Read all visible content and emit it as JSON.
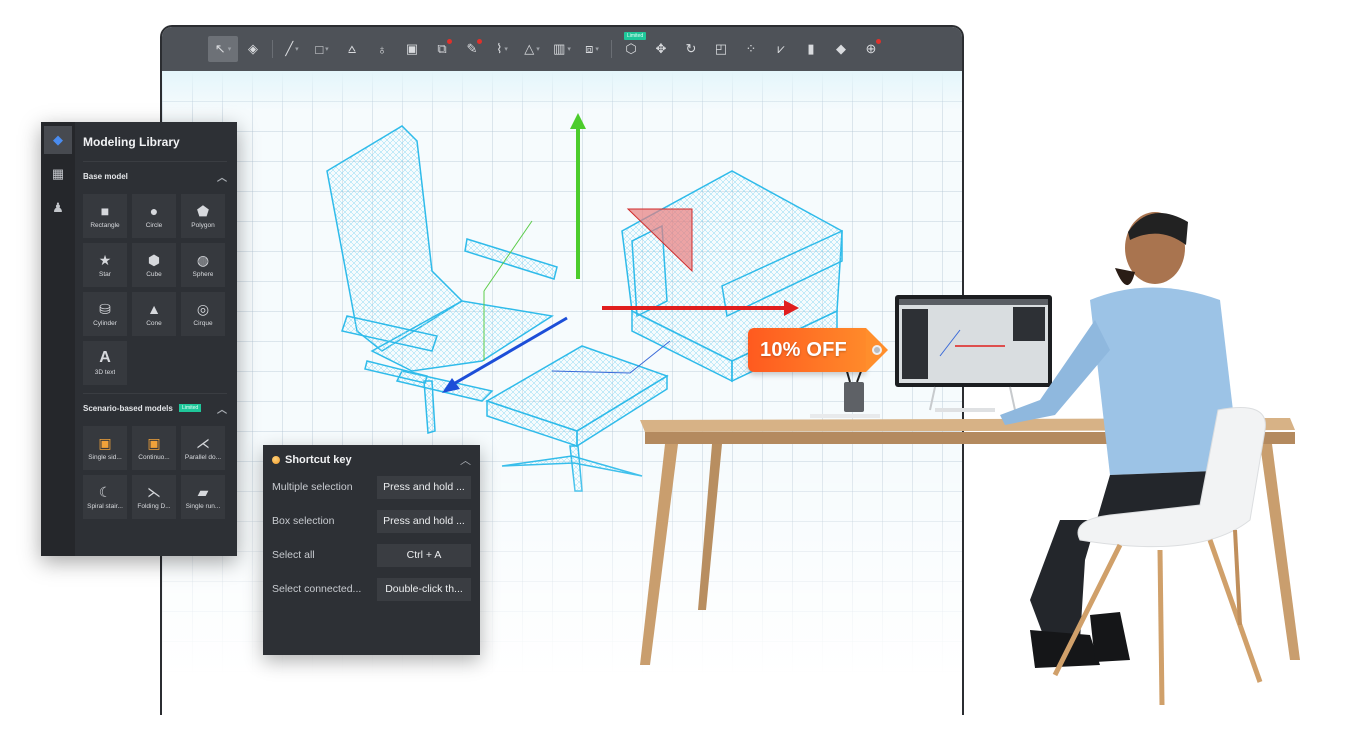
{
  "toolbar": {
    "tools": [
      {
        "name": "select-tool",
        "glyph": "↖",
        "caret": true,
        "active": true
      },
      {
        "name": "paint-tool",
        "glyph": "◈"
      },
      {
        "sep": true
      },
      {
        "name": "line-tool",
        "glyph": "╱",
        "caret": true
      },
      {
        "name": "rectangle-tool",
        "glyph": "□",
        "caret": true
      },
      {
        "name": "push-pull-tool",
        "glyph": "⩟"
      },
      {
        "name": "follow-me-tool",
        "glyph": "♁"
      },
      {
        "name": "offset-tool",
        "glyph": "▣"
      },
      {
        "name": "boolean-tool",
        "glyph": "⧉",
        "dot": true
      },
      {
        "name": "pen-tool",
        "glyph": "✎",
        "dot": true
      },
      {
        "name": "curve-tool",
        "glyph": "⌇",
        "caret": true
      },
      {
        "name": "mirror-tool",
        "glyph": "△",
        "caret": true
      },
      {
        "name": "align-tool",
        "glyph": "▥",
        "caret": true
      },
      {
        "name": "group-tool",
        "glyph": "⧈",
        "caret": true
      },
      {
        "sep": true
      },
      {
        "name": "ai-model-tool",
        "glyph": "⬡",
        "limited": "Limited"
      },
      {
        "name": "move-tool",
        "glyph": "✥"
      },
      {
        "name": "rotate-tool",
        "glyph": "↻"
      },
      {
        "name": "scale-tool",
        "glyph": "◰"
      },
      {
        "name": "array-tool",
        "glyph": "⁘"
      },
      {
        "name": "vertex-tool",
        "glyph": "⩗"
      },
      {
        "name": "split-tool",
        "glyph": "▮"
      },
      {
        "name": "material-tool",
        "glyph": "◆"
      },
      {
        "name": "component-tool",
        "glyph": "⊕",
        "dot": true
      }
    ]
  },
  "library": {
    "title": "Modeling Library",
    "rail": [
      {
        "name": "modeling-library-tab",
        "glyph": "◆",
        "active": true
      },
      {
        "name": "materials-tab",
        "glyph": "▦"
      },
      {
        "name": "people-tab",
        "glyph": "♟"
      }
    ],
    "base": {
      "title": "Base model",
      "items": [
        {
          "label": "Rectangle",
          "glyph": "■"
        },
        {
          "label": "Circle",
          "glyph": "●"
        },
        {
          "label": "Polygon",
          "glyph": "⬟"
        },
        {
          "label": "Star",
          "glyph": "★"
        },
        {
          "label": "Cube",
          "glyph": "⬢"
        },
        {
          "label": "Sphere",
          "glyph": "◍"
        },
        {
          "label": "Cylinder",
          "glyph": "⛁"
        },
        {
          "label": "Cone",
          "glyph": "▲"
        },
        {
          "label": "Cirque",
          "glyph": "◎"
        },
        {
          "label": "3D text",
          "glyph": "A"
        }
      ]
    },
    "scenario": {
      "title": "Scenario-based models",
      "badge": "Limited",
      "items": [
        {
          "label": "Single sid...",
          "glyph": "▣",
          "orange": true
        },
        {
          "label": "Continuo...",
          "glyph": "▣",
          "orange": true
        },
        {
          "label": "Parallel do...",
          "glyph": "⋌"
        },
        {
          "label": "Spiral stair...",
          "glyph": "☾"
        },
        {
          "label": "Folding D...",
          "glyph": "⋋"
        },
        {
          "label": "Single run...",
          "glyph": "▰"
        }
      ]
    }
  },
  "shortcuts": {
    "title": "Shortcut key",
    "rows": [
      {
        "action": "Multiple selection",
        "key": "Press and hold ..."
      },
      {
        "action": "Box selection",
        "key": "Press and hold ..."
      },
      {
        "action": "Select all",
        "key": "Ctrl + A"
      },
      {
        "action": "Select connected...",
        "key": "Double-click th..."
      }
    ]
  },
  "promo": {
    "text": "10% OFF"
  },
  "colors": {
    "accent_green": "#1fc79a",
    "axis_x": "#e01e1e",
    "axis_y": "#4ccc2c",
    "axis_z": "#1c4ed8",
    "wire": "#33c3f0",
    "tag": "#ff6a22"
  }
}
